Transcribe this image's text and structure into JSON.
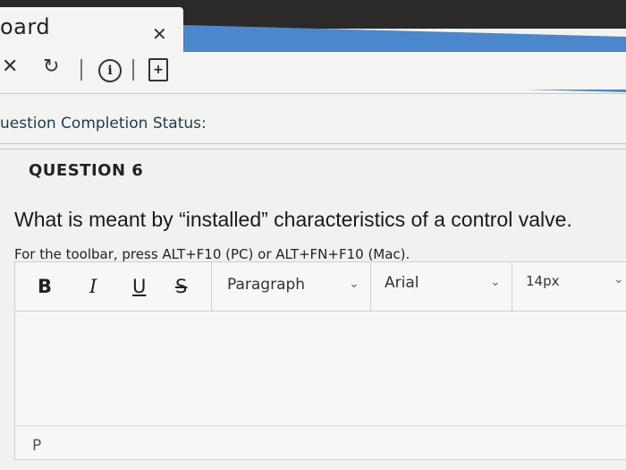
{
  "browser": {
    "tab_title": "oard",
    "tab_close": "✕"
  },
  "toolbar": {
    "close_icon": "✕",
    "refresh_icon": "↻",
    "info_icon": "i",
    "doc_icon": "+"
  },
  "status": {
    "label": "uestion Completion Status:"
  },
  "question": {
    "number_label": "QUESTION 6",
    "text": "What is meant by “installed” characteristics of a control valve.",
    "toolbar_hint": "For the toolbar, press ALT+F10 (PC) or ALT+FN+F10 (Mac)."
  },
  "editor": {
    "bold": "B",
    "italic": "I",
    "underline": "U",
    "strike": "S",
    "paragraph_select": "Paragraph",
    "font_select": "Arial",
    "size_select": "14px",
    "path_indicator": "P"
  },
  "colors": {
    "accent_blue": "#4a87cc",
    "status_text": "#1e3b4c",
    "background": "#f3f4f2"
  }
}
